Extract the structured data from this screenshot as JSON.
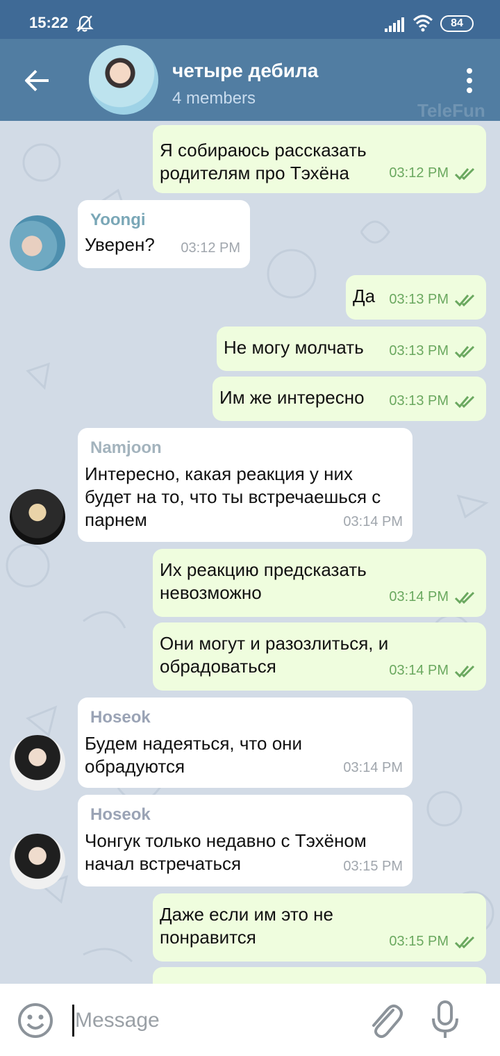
{
  "status_bar": {
    "time": "15:22",
    "battery": "84"
  },
  "header": {
    "title": "четыре дебила",
    "subtitle": "4 members",
    "watermark": "TeleFun"
  },
  "colors": {
    "header": "#517da2",
    "statusbar": "#3f6a96",
    "outgoing_bubble": "#effdde",
    "incoming_bubble": "#ffffff",
    "check": "#6aa85f"
  },
  "messages": [
    {
      "direction": "out",
      "lines": [
        "Я собираюсь рассказать",
        "родителям про Тэхёна"
      ],
      "time": "03:12 PM"
    },
    {
      "direction": "in",
      "sender": "Yoongi",
      "lines": [
        "Уверен?"
      ],
      "time": "03:12 PM"
    },
    {
      "direction": "out",
      "lines": [
        "Да"
      ],
      "time": "03:13 PM"
    },
    {
      "direction": "out",
      "lines": [
        "Не могу молчать"
      ],
      "time": "03:13 PM"
    },
    {
      "direction": "out",
      "lines": [
        "Им же интересно"
      ],
      "time": "03:13 PM"
    },
    {
      "direction": "in",
      "sender": "Namjoon",
      "lines": [
        "Интересно, какая реакция у них",
        "будет на то, что ты встречаешься с",
        "парнем"
      ],
      "time": "03:14 PM"
    },
    {
      "direction": "out",
      "lines": [
        "Их реакцию предсказать",
        "невозможно"
      ],
      "time": "03:14 PM"
    },
    {
      "direction": "out",
      "lines": [
        "Они могут и разозлиться, и",
        "обрадоваться"
      ],
      "time": "03:14 PM"
    },
    {
      "direction": "in",
      "sender": "Hoseok",
      "lines": [
        "Будем надеяться, что они",
        "обрадуются"
      ],
      "time": "03:14 PM"
    },
    {
      "direction": "in",
      "sender": "Hoseok",
      "lines": [
        "Чонгук только недавно с Тэхёном",
        "начал встречаться"
      ],
      "time": "03:15 PM"
    },
    {
      "direction": "out",
      "lines": [
        "Даже если им это не",
        "понравится"
      ],
      "time": "03:15 PM"
    }
  ],
  "input": {
    "placeholder": "Message"
  }
}
